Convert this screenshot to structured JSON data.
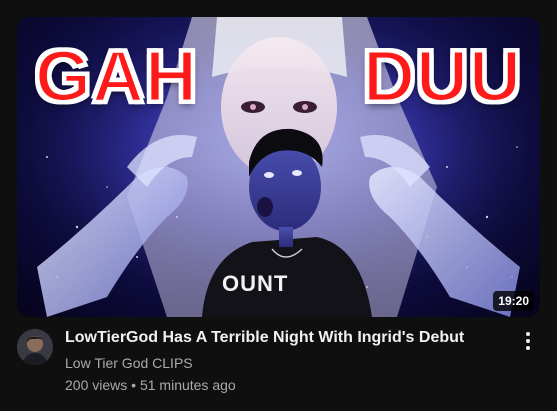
{
  "video": {
    "title": "LowTierGod Has A Terrible Night With Ingrid's Debut",
    "channel": "Low Tier God CLIPS",
    "views": "200 views",
    "separator": "•",
    "age": "51 minutes ago",
    "duration": "19:20"
  },
  "thumbnail": {
    "left_text": "GAH",
    "right_text": "DUU",
    "shirt_text": "OUNT"
  },
  "icons": {
    "more": "more-vert-icon",
    "avatar": "channel-avatar"
  },
  "colors": {
    "background": "#0f0f0f",
    "title": "#f1f1f1",
    "secondary": "#aaaaaa",
    "overlay_text": "#ff1a1a"
  }
}
